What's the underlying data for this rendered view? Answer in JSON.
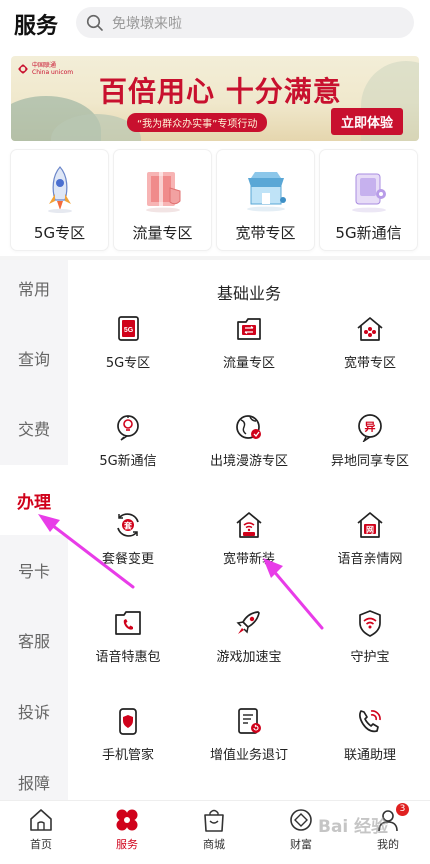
{
  "header": {
    "title": "服务",
    "search_placeholder": "免墩墩来啦"
  },
  "banner": {
    "logo_text_cn": "中国联通",
    "logo_text_en": "China unicom",
    "headline": "百倍用心 十分满意",
    "subtitle": "“我为群众办实事”专项行动",
    "cta": "立即体验"
  },
  "feature_cards": [
    {
      "label": "5G专区",
      "icon": "rocket-icon"
    },
    {
      "label": "流量专区",
      "icon": "gift-box-icon"
    },
    {
      "label": "宽带专区",
      "icon": "store-icon"
    },
    {
      "label": "5G新通信",
      "icon": "message-box-icon"
    }
  ],
  "sidebar": {
    "items": [
      {
        "label": "常用"
      },
      {
        "label": "查询"
      },
      {
        "label": "交费"
      },
      {
        "label": "办理"
      },
      {
        "label": "号卡"
      },
      {
        "label": "客服"
      },
      {
        "label": "投诉"
      },
      {
        "label": "报障"
      }
    ],
    "active_index": 3
  },
  "section": {
    "title": "基础业务",
    "items": [
      {
        "label": "5G专区",
        "icon": "5g-card-icon"
      },
      {
        "label": "流量专区",
        "icon": "data-transfer-icon"
      },
      {
        "label": "宽带专区",
        "icon": "home-network-icon"
      },
      {
        "label": "5G新通信",
        "icon": "bulb-chat-icon"
      },
      {
        "label": "出境漫游专区",
        "icon": "globe-icon"
      },
      {
        "label": "异地同享专区",
        "icon": "remote-share-icon"
      },
      {
        "label": "套餐变更",
        "icon": "package-change-icon"
      },
      {
        "label": "宽带新装",
        "icon": "home-wifi-new-icon"
      },
      {
        "label": "语音亲情网",
        "icon": "family-network-icon"
      },
      {
        "label": "语音特惠包",
        "icon": "phone-folder-icon"
      },
      {
        "label": "游戏加速宝",
        "icon": "rocket-boost-icon"
      },
      {
        "label": "守护宝",
        "icon": "shield-wifi-icon"
      },
      {
        "label": "手机管家",
        "icon": "phone-shield-icon"
      },
      {
        "label": "增值业务退订",
        "icon": "unsubscribe-icon"
      },
      {
        "label": "联通助理",
        "icon": "phone-assistant-icon"
      }
    ]
  },
  "tabbar": {
    "items": [
      {
        "label": "首页",
        "icon": "home-icon"
      },
      {
        "label": "服务",
        "icon": "service-grid-icon"
      },
      {
        "label": "商城",
        "icon": "shopping-bag-icon"
      },
      {
        "label": "财富",
        "icon": "wealth-icon"
      },
      {
        "label": "我的",
        "icon": "user-icon"
      }
    ],
    "active_index": 1,
    "badge": "3"
  },
  "watermark": "Bai 经验",
  "colors": {
    "brand_red": "#d0021b",
    "arrow_magenta": "#e83ce8"
  }
}
